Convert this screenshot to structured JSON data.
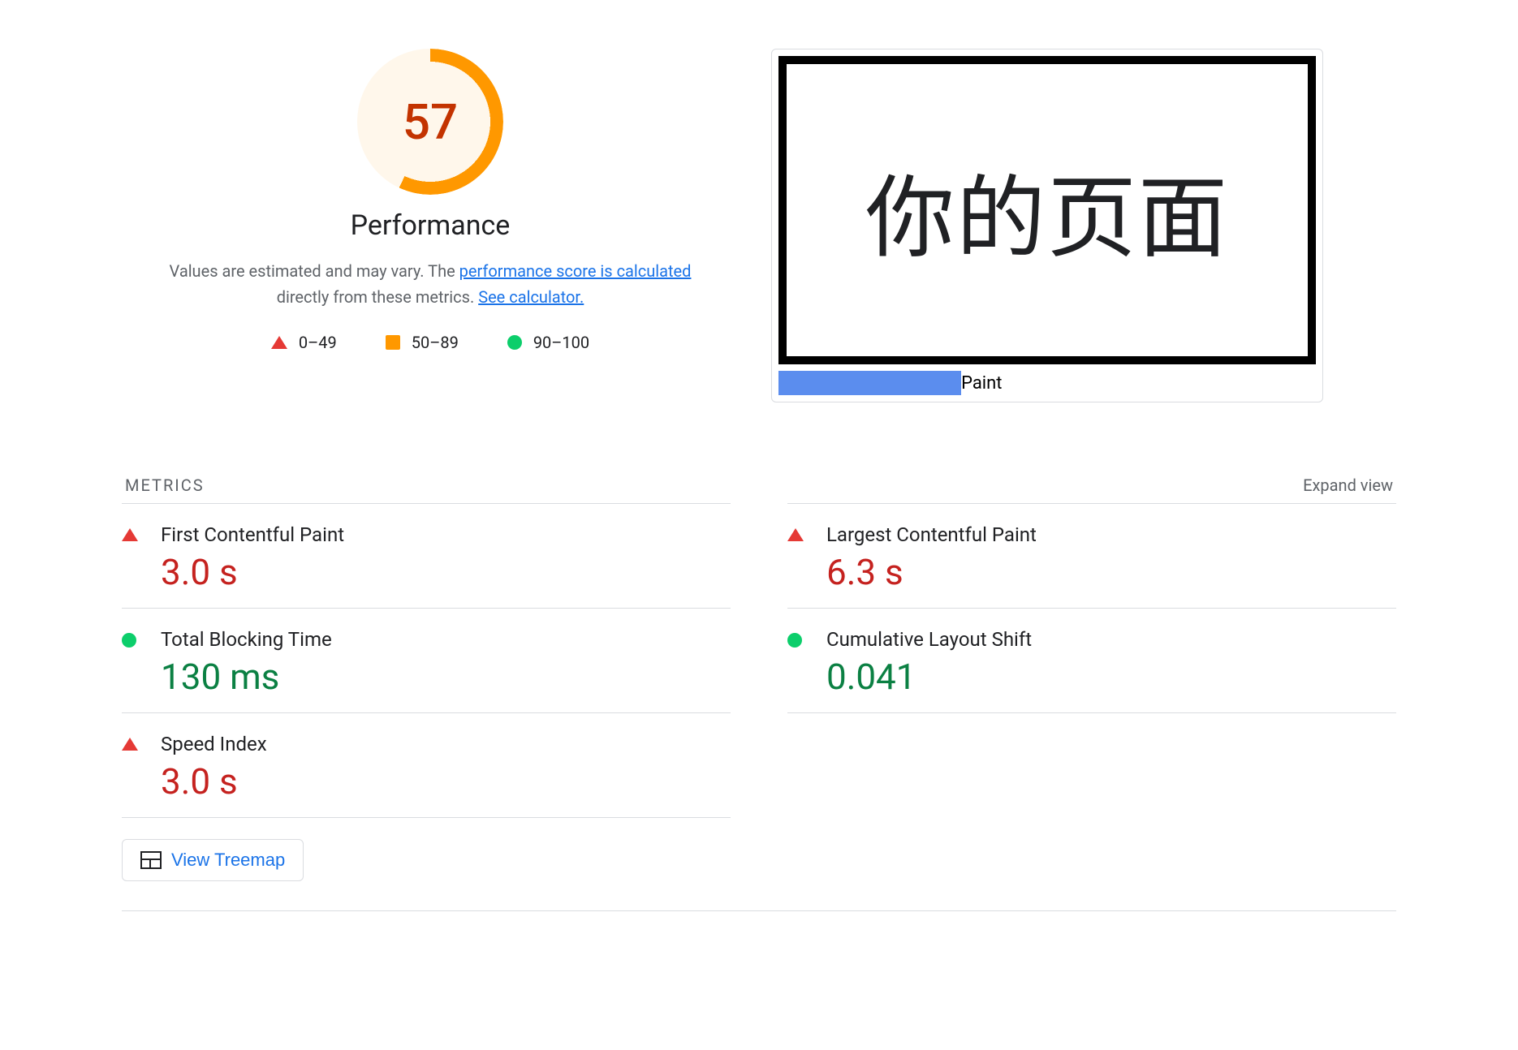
{
  "score": {
    "value": "57",
    "title": "Performance",
    "description_prefix": "Values are estimated and may vary. The ",
    "link1": "performance score is calculated",
    "description_middle": " directly from these metrics. ",
    "link2": "See calculator."
  },
  "legend": {
    "red": "0–49",
    "orange": "50–89",
    "green": "90–100"
  },
  "preview": {
    "page_text": "你的页面",
    "bar_label": "Paint"
  },
  "section": {
    "metrics_title": "METRICS",
    "expand": "Expand view"
  },
  "metrics": {
    "left": [
      {
        "label": "First Contentful Paint",
        "value": "3.0 s",
        "status": "red"
      },
      {
        "label": "Total Blocking Time",
        "value": "130 ms",
        "status": "green"
      },
      {
        "label": "Speed Index",
        "value": "3.0 s",
        "status": "red"
      }
    ],
    "right": [
      {
        "label": "Largest Contentful Paint",
        "value": "6.3 s",
        "status": "red"
      },
      {
        "label": "Cumulative Layout Shift",
        "value": "0.041",
        "status": "green"
      }
    ]
  },
  "treemap_button": "View Treemap"
}
